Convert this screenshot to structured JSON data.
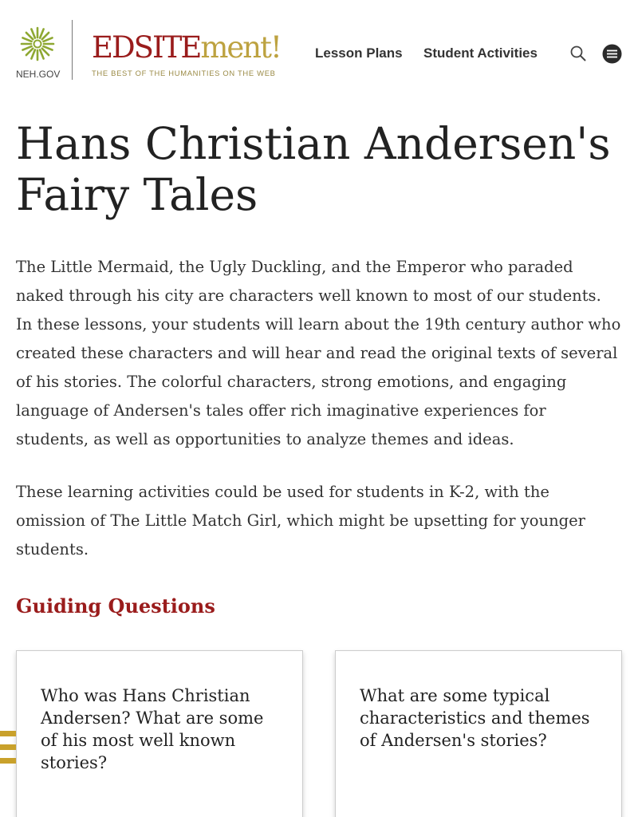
{
  "header": {
    "neh_label": "NEH.GOV",
    "brand_red": "EDSITE",
    "brand_gold": "ment!",
    "tagline": "THE BEST OF THE HUMANITIES ON THE WEB",
    "nav": [
      {
        "label": "Lesson Plans"
      },
      {
        "label": "Student Activities"
      }
    ],
    "icons": {
      "search": "search-icon",
      "menu": "menu-icon",
      "neh_emblem": "neh-emblem-icon"
    }
  },
  "main": {
    "title": "Hans Christian Andersen's Fairy Tales",
    "intro_paragraphs": [
      "The Little Mermaid, the Ugly Duckling, and the Emperor who paraded naked through his city are characters well known to most of our students. In these lessons, your students will learn about the 19th century author who created these characters and will hear and read the original texts of several of his stories. The colorful characters, strong emotions, and engaging language of Andersen's tales offer rich imaginative experiences for students, as well as opportunities to analyze themes and ideas.",
      "These learning activities could be used for students in K-2, with the omission of The Little Match Girl, which might be upsetting for younger students."
    ],
    "guiding_heading": "Guiding Questions",
    "questions": [
      "Who was Hans Christian Andersen? What are some of his most well known stories?",
      "What are some typical characteristics and themes of Andersen's stories?"
    ]
  },
  "colors": {
    "brand_red": "#9a1c1c",
    "brand_gold": "#bda240",
    "emblem_green": "#8ea832",
    "side_tab_gold": "#c9a12b",
    "text_dark": "#222222"
  }
}
